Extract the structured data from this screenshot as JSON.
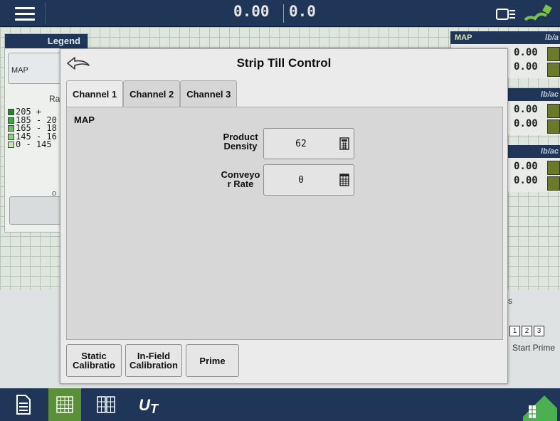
{
  "topbar": {
    "value1": "0.00",
    "value2": "0.0"
  },
  "legend": {
    "title": "Legend",
    "product": "MAP",
    "rate_label": "Ra",
    "ranges": [
      {
        "label": "205 +",
        "color": "#2e7d32"
      },
      {
        "label": "185 - 20",
        "color": "#43a047"
      },
      {
        "label": "165 - 18",
        "color": "#66bb6a"
      },
      {
        "label": "145 - 16",
        "color": "#8bd17c"
      },
      {
        "label": "0 - 145",
        "color": "#c8e6b0"
      }
    ],
    "footer_o": "o"
  },
  "right_panels": [
    {
      "name": "MAP",
      "unit": "lb/a",
      "val1": "0.00",
      "val2": "0.00"
    },
    {
      "name": "",
      "unit": "lb/ac",
      "val1": "0.00",
      "val2": "0.00"
    },
    {
      "name": "",
      "unit": "lb/ac",
      "val1": "0.00",
      "val2": "0.00"
    }
  ],
  "right_side": {
    "s": "s",
    "channels": [
      "1",
      "2",
      "3"
    ],
    "start_prime": "Start Prime"
  },
  "dialog": {
    "title": "Strip Till Control",
    "tabs": [
      "Channel 1",
      "Channel 2",
      "Channel 3"
    ],
    "product": "MAP",
    "fields": [
      {
        "label": "Product Density",
        "value": "62"
      },
      {
        "label": "Conveyo r Rate",
        "value": "0"
      }
    ],
    "buttons": {
      "static": "Static Calibratio",
      "infield": "In-Field Calibration",
      "prime": "Prime"
    }
  },
  "colors": {
    "nav": "#1f3658",
    "active_nav": "#5b8f3a",
    "dialog_bg": "#ebebeb"
  }
}
